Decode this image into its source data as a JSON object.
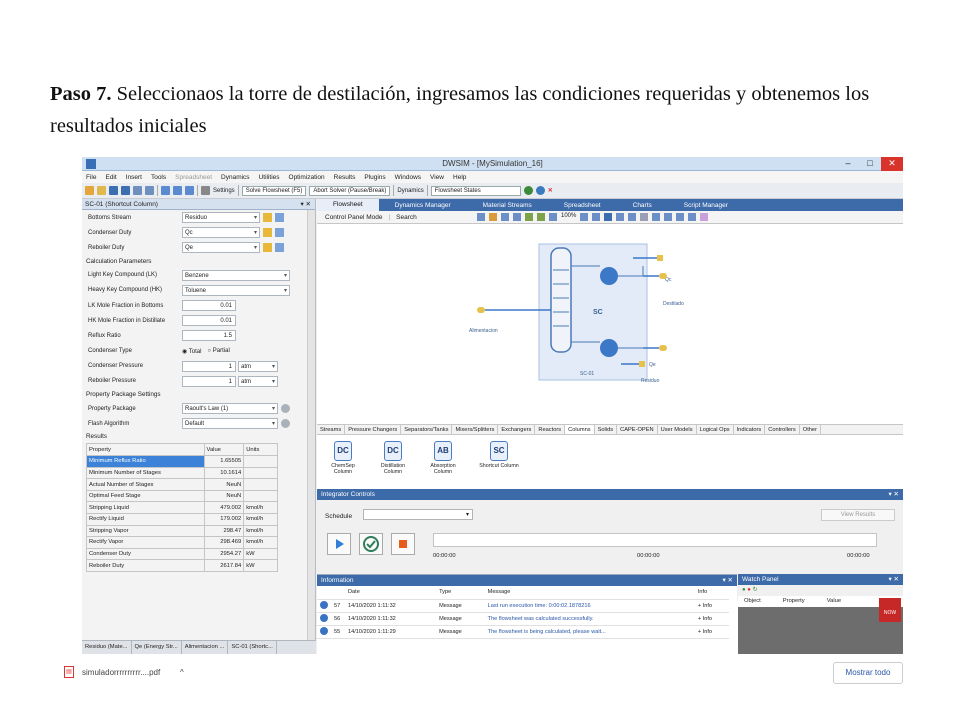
{
  "document": {
    "step_label": "Paso 7.",
    "step_text": " Seleccionaos la torre de destilación, ingresamos las condiciones requeridas y obtenemos los resultados iniciales"
  },
  "app": {
    "title": "DWSIM - [MySimulation_16]",
    "menu": [
      "File",
      "Edit",
      "Insert",
      "Tools",
      "Spreadsheet",
      "Dynamics",
      "Utilities",
      "Optimization",
      "Results",
      "Plugins",
      "Windows",
      "View",
      "Help"
    ],
    "toolbar": {
      "settings": "Settings",
      "solve": "Solve Flowsheet (F5)",
      "abort": "Abort Solver (Pause/Break)",
      "dynamics": "Dynamics",
      "states": "Flowsheet States"
    }
  },
  "left_panel": {
    "title": "SC-01 (Shortcut Column)",
    "streams": [
      {
        "label": "Bottoms Stream",
        "value": "Residuo"
      },
      {
        "label": "Condenser Duty",
        "value": "Qc"
      },
      {
        "label": "Reboiler Duty",
        "value": "Qe"
      }
    ],
    "calc_header": "Calculation Parameters",
    "calc": [
      {
        "label": "Light Key Compound (LK)",
        "value": "Benzene"
      },
      {
        "label": "Heavy Key Compound (HK)",
        "value": "Toluene"
      },
      {
        "label": "LK Mole Fraction in Bottoms",
        "value": "0.01"
      },
      {
        "label": "HK Mole Fraction in Distillate",
        "value": "0.01"
      },
      {
        "label": "Reflux Ratio",
        "value": "1.5"
      }
    ],
    "condenser_type_label": "Condenser Type",
    "condenser_total": "Total",
    "condenser_partial": "Partial",
    "condenser_pressure": {
      "label": "Condenser Pressure",
      "value": "1",
      "unit": "atm"
    },
    "reboiler_pressure": {
      "label": "Reboiler Pressure",
      "value": "1",
      "unit": "atm"
    },
    "pp_header": "Property Package Settings",
    "property_package": {
      "label": "Property Package",
      "value": "Raoult's Law (1)"
    },
    "flash_algorithm": {
      "label": "Flash Algorithm",
      "value": "Default"
    },
    "results_header": "Results",
    "results_cols": [
      "Property",
      "Value",
      "Units"
    ],
    "results": [
      {
        "p": "Minimum Reflux Ratio",
        "v": "1.65505",
        "u": ""
      },
      {
        "p": "Minimum Number of Stages",
        "v": "10.1614",
        "u": ""
      },
      {
        "p": "Actual Number of Stages",
        "v": "NeuN",
        "u": ""
      },
      {
        "p": "Optimal Feed Stage",
        "v": "NeuN",
        "u": ""
      },
      {
        "p": "Stripping Liquid",
        "v": "479.002",
        "u": "kmol/h"
      },
      {
        "p": "Rectify Liquid",
        "v": "179.002",
        "u": "kmol/h"
      },
      {
        "p": "Stripping Vapor",
        "v": "298.47",
        "u": "kmol/h"
      },
      {
        "p": "Rectify Vapor",
        "v": "298.469",
        "u": "kmol/h"
      },
      {
        "p": "Condenser Duty",
        "v": "2954.27",
        "u": "kW"
      },
      {
        "p": "Reboiler Duty",
        "v": "2617.84",
        "u": "kW"
      }
    ],
    "bottom_tabs": [
      "Residuo (Mate...",
      "Qe (Energy Str...",
      "Alimentacion ...",
      "SC-01 (Shortc..."
    ]
  },
  "tabs": [
    "Flowsheet",
    "Dynamics Manager",
    "Material Streams",
    "Spreadsheet",
    "Charts",
    "Script Manager"
  ],
  "flowsheet": {
    "mode": "Control Panel Mode",
    "search": "Search",
    "zoom": "100%",
    "labels": {
      "sc": "SC",
      "sc01": "SC-01",
      "qc": "Qc",
      "qe": "Qe",
      "destilado": "Destilado",
      "residuo": "Residuo",
      "alimentacion": "Alimentacion"
    }
  },
  "category_tabs": [
    "Streams",
    "Pressure Changers",
    "Separators/Tanks",
    "Mixers/Splitters",
    "Exchangers",
    "Reactors",
    "Columns",
    "Solids",
    "CAPE-OPEN",
    "User Models",
    "Logical Ops",
    "Indicators",
    "Controllers",
    "Other"
  ],
  "palette": [
    {
      "icon": "DC",
      "label": "ChemSep Column"
    },
    {
      "icon": "DC",
      "label": "Distillation Column"
    },
    {
      "icon": "AB",
      "label": "Absorption Column"
    },
    {
      "icon": "SC",
      "label": "Shortcut Column"
    }
  ],
  "integrator": {
    "title": "Integrator Controls",
    "schedule": "Schedule",
    "view_results": "View Results",
    "t_start": "00:00:00",
    "t_mid": "00:00:00",
    "t_end": "00:00:00"
  },
  "information": {
    "title": "Information",
    "cols": [
      "Date",
      "Type",
      "Message",
      "Info"
    ],
    "rows": [
      {
        "n": "57",
        "date": "14/10/2020 1:11:32",
        "type": "Message",
        "msg": "Last run execution time: 0:00:02.1878216",
        "info": "+ Info"
      },
      {
        "n": "56",
        "date": "14/10/2020 1:11:32",
        "type": "Message",
        "msg": "The flowsheet was calculated successfully.",
        "info": "+ Info"
      },
      {
        "n": "55",
        "date": "14/10/2020 1:11:29",
        "type": "Message",
        "msg": "The flowsheet is being calculated, please wait...",
        "info": "+ Info"
      }
    ]
  },
  "watch": {
    "title": "Watch Panel",
    "cols": [
      "Object",
      "Property",
      "Value"
    ],
    "badge": "NOW"
  },
  "download_bar": {
    "filename": "simuladorrrrrrrrrr....pdf",
    "show_all": "Mostrar todo"
  },
  "colors": {
    "accent": "#3d6aa8",
    "selected": "#3b82d8",
    "play": "#2f7fd6",
    "stop": "#e85b1c",
    "check": "#2e7d5b"
  }
}
